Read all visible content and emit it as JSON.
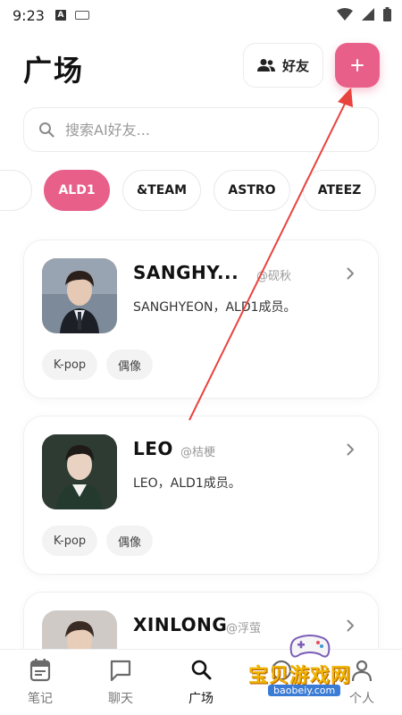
{
  "status_bar": {
    "time": "9:23",
    "left_icons": [
      "a-notification-icon",
      "keyboard-icon"
    ],
    "right_icons": [
      "wifi-icon",
      "cellular-icon",
      "battery-icon"
    ]
  },
  "header": {
    "title": "广场",
    "friends_label": "好友",
    "add_label": "+"
  },
  "search": {
    "placeholder": "搜索AI好友..."
  },
  "chips": [
    {
      "label": "",
      "active": false
    },
    {
      "label": "ALD1",
      "active": true
    },
    {
      "label": "&TEAM",
      "active": false
    },
    {
      "label": "ASTRO",
      "active": false
    },
    {
      "label": "ATEEZ",
      "active": false
    }
  ],
  "cards": [
    {
      "name": "SANGHY...",
      "handle": "@砚秋",
      "desc": "SANGHYEON，ALD1成员。",
      "tags": [
        "K-pop",
        "偶像"
      ]
    },
    {
      "name": "LEO",
      "handle": "@桔梗",
      "desc": "LEO，ALD1成员。",
      "tags": [
        "K-pop",
        "偶像"
      ]
    },
    {
      "name": "XINLONG",
      "handle": "@浮萤",
      "desc": "",
      "tags": []
    }
  ],
  "bottom_nav": [
    {
      "label": "笔记",
      "icon": "notebook-icon",
      "active": false
    },
    {
      "label": "聊天",
      "icon": "chat-icon",
      "active": false
    },
    {
      "label": "广场",
      "icon": "search-icon",
      "active": true
    },
    {
      "label": "",
      "icon": "explore-icon",
      "active": false
    },
    {
      "label": "个人",
      "icon": "profile-icon",
      "active": false
    }
  ],
  "watermark": {
    "text": "宝贝游戏网",
    "url": "baobeiy.com"
  },
  "colors": {
    "accent": "#e8608a",
    "annotation_arrow": "#e8433f"
  }
}
